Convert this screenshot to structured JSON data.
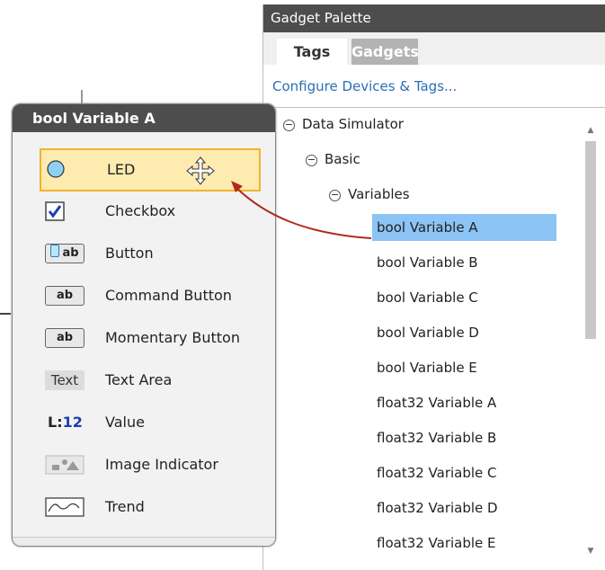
{
  "palette": {
    "title": "Gadget Palette",
    "tabs": [
      {
        "label": "Tags",
        "active": true
      },
      {
        "label": "Gadgets",
        "active": false
      }
    ],
    "configure_link": "Configure Devices & Tags...",
    "tree": [
      {
        "label": "Data Simulator",
        "expander": "⊖",
        "level": 0
      },
      {
        "label": "Basic",
        "expander": "⊖",
        "level": 1
      },
      {
        "label": "Variables",
        "expander": "⊖",
        "level": 2
      },
      {
        "label": "bool Variable A",
        "level": 3,
        "selected": true
      },
      {
        "label": "bool Variable B",
        "level": 3
      },
      {
        "label": "bool Variable C",
        "level": 3
      },
      {
        "label": "bool Variable D",
        "level": 3
      },
      {
        "label": "bool Variable E",
        "level": 3
      },
      {
        "label": "float32 Variable A",
        "level": 3
      },
      {
        "label": "float32 Variable B",
        "level": 3
      },
      {
        "label": "float32 Variable C",
        "level": 3
      },
      {
        "label": "float32 Variable D",
        "level": 3
      },
      {
        "label": "float32 Variable E",
        "level": 3
      }
    ]
  },
  "popup": {
    "title": "bool Variable A",
    "gadgets": [
      {
        "label": "LED",
        "icon": "led-icon",
        "highlighted": true
      },
      {
        "label": "Checkbox",
        "icon": "checkbox-icon"
      },
      {
        "label": "Button",
        "icon": "button-icon",
        "icon_text": "ab"
      },
      {
        "label": "Command Button",
        "icon": "command-button-icon",
        "icon_text": "ab"
      },
      {
        "label": "Momentary Button",
        "icon": "momentary-button-icon",
        "icon_text": "ab"
      },
      {
        "label": "Text Area",
        "icon": "text-area-icon",
        "icon_text": "Text"
      },
      {
        "label": "Value",
        "icon": "value-icon",
        "icon_text": "L:",
        "icon_num": "12"
      },
      {
        "label": "Image Indicator",
        "icon": "image-indicator-icon"
      },
      {
        "label": "Trend",
        "icon": "trend-icon"
      }
    ]
  },
  "colors": {
    "title_bar": "#4d4d4d",
    "selection": "#8cc4f5",
    "highlight_fill": "#fdebb0",
    "highlight_border": "#f0b42c",
    "arrow": "#b02a1a",
    "link": "#2a6fb5"
  }
}
